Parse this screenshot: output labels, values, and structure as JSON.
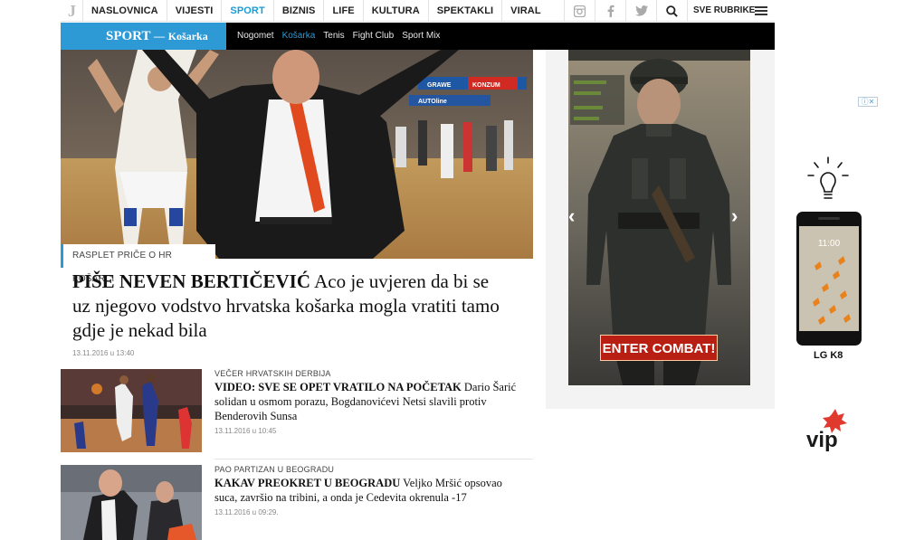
{
  "logo": "J",
  "nav": {
    "items": [
      "NASLOVNICA",
      "VIJESTI",
      "SPORT",
      "BIZNIS",
      "LIFE",
      "KULTURA",
      "SPEKTAKLI",
      "VIRAL"
    ],
    "active": "SPORT",
    "all_sections": "SVE RUBRIKE"
  },
  "section": {
    "title": "SPORT",
    "separator": "—",
    "subtitle": "Košarka",
    "subnav": [
      "Nogomet",
      "Košarka",
      "Tenis",
      "Fight Club",
      "Sport Mix"
    ],
    "active_sub": "Košarka"
  },
  "hero": {
    "kicker": "RASPLET PRIČE O HR KOŠARCI",
    "title_bold": "PIŠE NEVEN BERTIČEVIĆ",
    "title_rest": "Aco je uvjeren da bi se uz njegovo vodstvo hrvatska košarka mogla vratiti tamo gdje je nekad bila",
    "date": "13.11.2016 u 13:40",
    "banner_brands": [
      "GRAWE",
      "KONZUM",
      "AUTOline"
    ]
  },
  "articles": [
    {
      "kicker": "VEČER HRVATSKIH DERBIJA",
      "title_bold": "VIDEO: SVE SE OPET VRATILO NA POČETAK",
      "title_rest": "Dario Šarić solidan u osmom porazu, Bogdanovićevi Netsi slavili protiv Benderovih Sunsa",
      "date": "13.11.2016 u 10:45"
    },
    {
      "kicker": "PAO PARTIZAN U BEOGRADU",
      "title_bold": "KAKAV PREOKRET U BEOGRADU",
      "title_rest": "Veljko Mršić opsovao suca, završio na tribini, a onda je Cedevita okrenula -17",
      "date": "13.11.2016 u 09:29."
    }
  ],
  "ad_game": {
    "button": "ENTER COMBAT!",
    "prev": "‹",
    "next": "›"
  },
  "ad_phone": {
    "close_label": "ⓘ✕",
    "model": "LG K8",
    "brand": "vip",
    "phone_time": "11:00"
  },
  "colors": {
    "accent": "#2d9ad6",
    "section_bar": "#000000",
    "enter_button": "#b81f12",
    "vip_red": "#e03a2f"
  },
  "icons": [
    "instagram-icon",
    "facebook-icon",
    "twitter-icon",
    "search-icon",
    "menu-icon"
  ]
}
